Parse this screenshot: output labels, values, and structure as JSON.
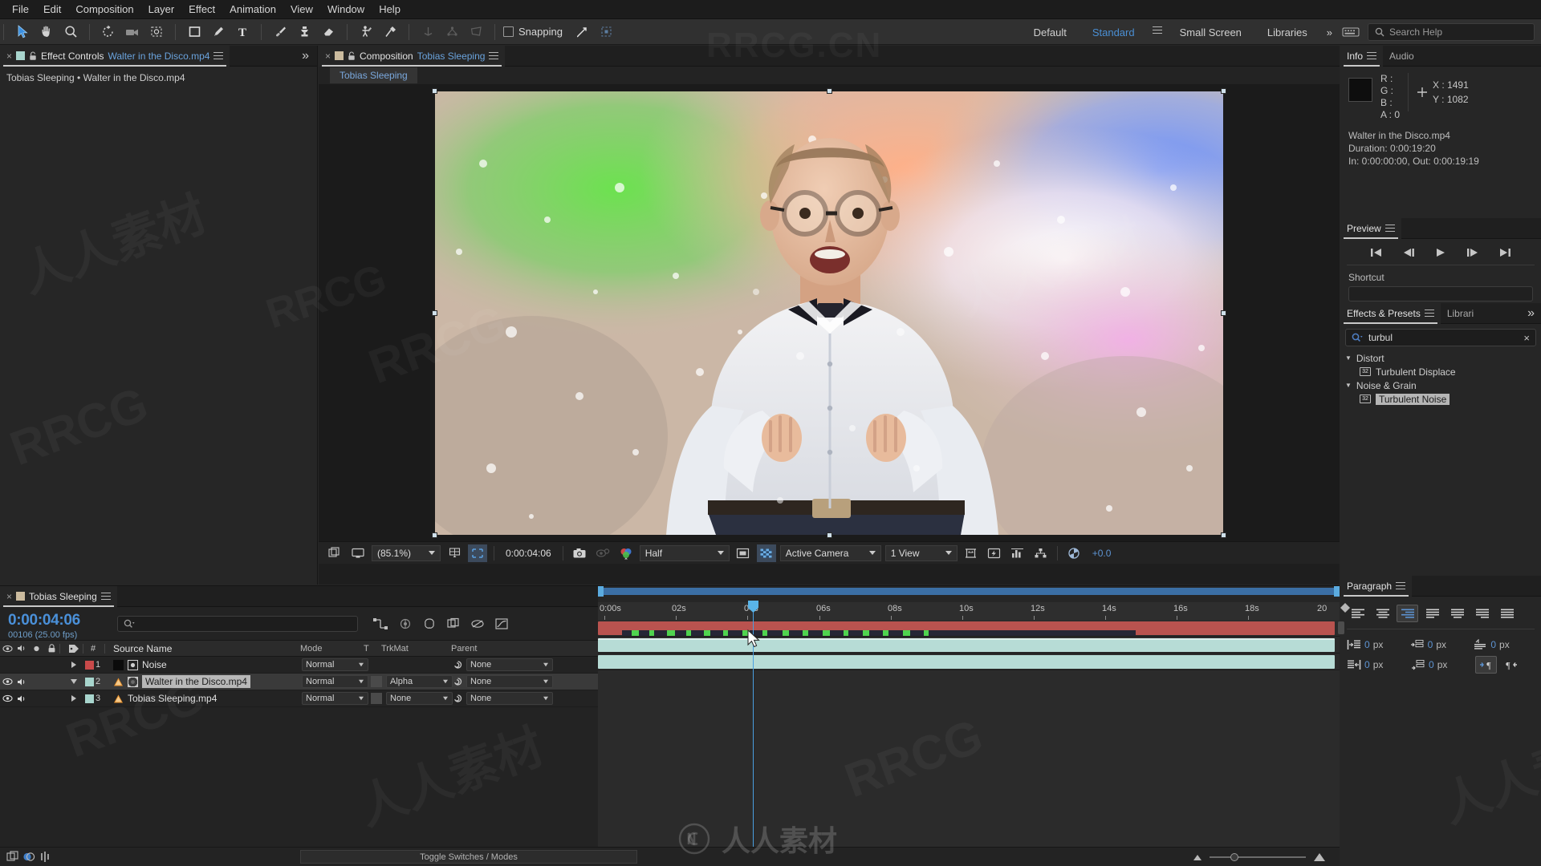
{
  "menu": {
    "items": [
      "File",
      "Edit",
      "Composition",
      "Layer",
      "Effect",
      "Animation",
      "View",
      "Window",
      "Help"
    ]
  },
  "toolbar": {
    "snapping_label": "Snapping",
    "workspaces": [
      {
        "label": "Default",
        "selected": false
      },
      {
        "label": "Standard",
        "selected": true
      },
      {
        "label": "Small Screen",
        "selected": false
      },
      {
        "label": "Libraries",
        "selected": false
      }
    ],
    "search_placeholder": "Search Help",
    "overflow_label": "»",
    "tools": [
      "selection-tool",
      "hand-tool",
      "zoom-tool",
      "rotation-tool",
      "camera-tool",
      "pan-behind-tool",
      "rectangle-tool",
      "pen-tool",
      "type-tool",
      "brush-tool",
      "clone-stamp-tool",
      "eraser-tool",
      "roto-brush-tool",
      "puppet-pin-tool"
    ]
  },
  "effect_controls": {
    "tab_prefix": "Effect Controls",
    "tab_target": "Walter in the Disco.mp4",
    "subtitle": "Tobias Sleeping • Walter in the Disco.mp4",
    "overflow": "»"
  },
  "composition": {
    "tab_prefix": "Composition",
    "tab_name": "Tobias Sleeping",
    "breadcrumb": "Tobias Sleeping",
    "toolbar": {
      "zoom_level": "(85.1%)",
      "timecode": "0:00:04:06",
      "resolution": "Half",
      "view_camera": "Active Camera",
      "view_layout": "1 View",
      "exposure": "+0.0"
    }
  },
  "info": {
    "tabs": [
      {
        "label": "Info",
        "active": true
      },
      {
        "label": "Audio",
        "active": false
      }
    ],
    "channels": [
      {
        "label": "R :",
        "value": ""
      },
      {
        "label": "G :",
        "value": ""
      },
      {
        "label": "B :",
        "value": ""
      },
      {
        "label": "A :",
        "value": "0"
      }
    ],
    "x_label": "X :",
    "x_value": "1491",
    "y_label": "Y :",
    "y_value": "1082",
    "source_name": "Walter in the Disco.mp4",
    "duration": "Duration: 0:00:19:20",
    "in_out": "In: 0:00:00:00, Out: 0:00:19:19"
  },
  "preview": {
    "title": "Preview",
    "shortcut_label": "Shortcut",
    "buttons": [
      "first-frame-icon",
      "previous-frame-icon",
      "play-icon",
      "next-frame-icon",
      "last-frame-icon"
    ]
  },
  "effects_presets": {
    "tabs": [
      {
        "label": "Effects & Presets",
        "active": true
      },
      {
        "label": "Librari",
        "active": false
      }
    ],
    "overflow": "»",
    "search_value": "turbul",
    "clear_icon": "×",
    "tree": [
      {
        "type": "group",
        "label": "Distort",
        "expanded": true
      },
      {
        "type": "effect",
        "label": "Turbulent Displace",
        "badge": "32",
        "selected": false
      },
      {
        "type": "group",
        "label": "Noise & Grain",
        "expanded": true
      },
      {
        "type": "effect",
        "label": "Turbulent Noise",
        "badge": "32",
        "selected": true
      }
    ]
  },
  "paragraph": {
    "title": "Paragraph",
    "align_buttons": [
      {
        "name": "align-left",
        "active": false
      },
      {
        "name": "align-center",
        "active": false
      },
      {
        "name": "align-right",
        "active": true
      },
      {
        "name": "justify-last-left",
        "active": false
      },
      {
        "name": "justify-last-center",
        "active": false
      },
      {
        "name": "justify-last-right",
        "active": false
      },
      {
        "name": "justify-all",
        "active": false
      }
    ],
    "fields": [
      {
        "name": "indent-left",
        "value": "0",
        "unit": "px"
      },
      {
        "name": "indent-right",
        "value": "0",
        "unit": "px"
      },
      {
        "name": "space-before",
        "value": "0",
        "unit": "px"
      },
      {
        "name": "indent-first-line",
        "value": "0",
        "unit": "px"
      },
      {
        "name": "space-after",
        "value": "0",
        "unit": "px"
      }
    ],
    "direction_buttons": [
      {
        "name": "ltr-paragraph",
        "active": true
      },
      {
        "name": "rtl-paragraph",
        "active": false
      }
    ]
  },
  "timeline": {
    "tab_name": "Tobias Sleeping",
    "current_time": "0:00:04:06",
    "frame_info": "00106 (25.00 fps)",
    "search_placeholder": "",
    "columns": {
      "num": "#",
      "source_name": "Source Name",
      "mode": "Mode",
      "t": "T",
      "trkmat": "TrkMat",
      "parent": "Parent"
    },
    "layers": [
      {
        "index": "1",
        "name": "Noise",
        "label_color": "#c84a4a",
        "mode": "Normal",
        "trkmat": "",
        "parent": "None",
        "visible": false,
        "audio": false,
        "selected": false,
        "expanded": false,
        "icon": "solid-icon",
        "bar_color": "#b9534f",
        "bar_start_pct": 0,
        "bar_end_pct": 100
      },
      {
        "index": "2",
        "name": "Walter in the Disco.mp4",
        "label_color": "#a8d5cd",
        "mode": "Normal",
        "trkmat": "Alpha",
        "parent": "None",
        "visible": true,
        "audio": true,
        "selected": true,
        "expanded": true,
        "icon": "video-icon",
        "bar_color": "#b7dcd6",
        "bar_start_pct": 0,
        "bar_end_pct": 100
      },
      {
        "index": "3",
        "name": "Tobias Sleeping.mp4",
        "label_color": "#a8d5cd",
        "mode": "Normal",
        "trkmat": "None",
        "parent": "None",
        "visible": true,
        "audio": true,
        "selected": false,
        "expanded": false,
        "icon": "video-icon",
        "bar_color": "#b7dcd6",
        "bar_start_pct": 0,
        "bar_end_pct": 100
      }
    ],
    "ruler_ticks": [
      "0:00s",
      "02s",
      "04s",
      "06s",
      "08s",
      "10s",
      "12s",
      "14s",
      "16s",
      "18s",
      "20"
    ],
    "toggle_switches_label": "Toggle Switches / Modes"
  },
  "watermarks": {
    "top_center": "RRCG.CN",
    "items": [
      "RRCG",
      "人人素材",
      "RRCG",
      "人人素材",
      "RRCG"
    ],
    "bottom": "人人素材"
  },
  "colors": {
    "accent_blue": "#4a90d9",
    "panel_bg": "#262626",
    "toolbar_bg": "#303030",
    "label_red": "#c84a4a",
    "label_teal": "#a8d5cd"
  }
}
